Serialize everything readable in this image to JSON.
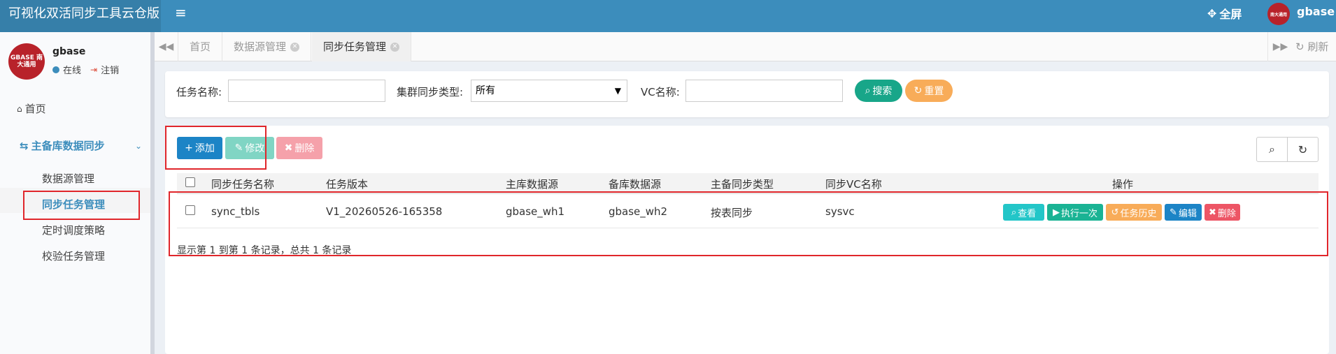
{
  "header": {
    "app_title": "可视化双活同步工具云仓版",
    "menu_icon": "≡",
    "fullscreen_label": "全屏",
    "avatar_text": "南大通用",
    "username": "gbase"
  },
  "sidebar": {
    "avatar_text": "GBASE 南大通用",
    "username": "gbase",
    "status_online": "在线",
    "logout": "注销",
    "home": "首页",
    "group": "主备库数据同步",
    "items": [
      "数据源管理",
      "同步任务管理",
      "定时调度策略",
      "校验任务管理"
    ],
    "active_item": "同步任务管理",
    "accent_color": "#3c8dbc"
  },
  "tabs": {
    "items": [
      "首页",
      "数据源管理",
      "同步任务管理"
    ],
    "active": "同步任务管理",
    "refresh": "刷新"
  },
  "search": {
    "task_name_label": "任务名称:",
    "task_name_value": "",
    "cluster_type_label": "集群同步类型:",
    "cluster_type_value": "所有",
    "vc_name_label": "VC名称:",
    "vc_name_value": "",
    "search_button": "搜索",
    "reset_button": "重置"
  },
  "toolbar": {
    "add": "添加",
    "edit": "修改",
    "delete": "删除"
  },
  "table": {
    "columns": [
      "同步任务名称",
      "任务版本",
      "主库数据源",
      "备库数据源",
      "主备同步类型",
      "同步VC名称",
      "操作"
    ],
    "rows": [
      {
        "task_name": "sync_tbls",
        "version": "V1_20260526-165358",
        "primary_source": "gbase_wh1",
        "standby_source": "gbase_wh2",
        "sync_type": "按表同步",
        "vc_name": "sysvc",
        "actions": [
          "查看",
          "执行一次",
          "任务历史",
          "编辑",
          "删除"
        ]
      }
    ],
    "footer": "显示第 1 到第 1 条记录，总共 1 条记录"
  },
  "colors": {
    "header_bg": "#3c8dbc",
    "brand_bg": "#367fa9",
    "add_btn": "#1c84c6",
    "success": "#18a689",
    "warning": "#f8ac59",
    "danger": "#ed5565",
    "info": "#23c6c8",
    "annotation_red": "#e0262b"
  }
}
